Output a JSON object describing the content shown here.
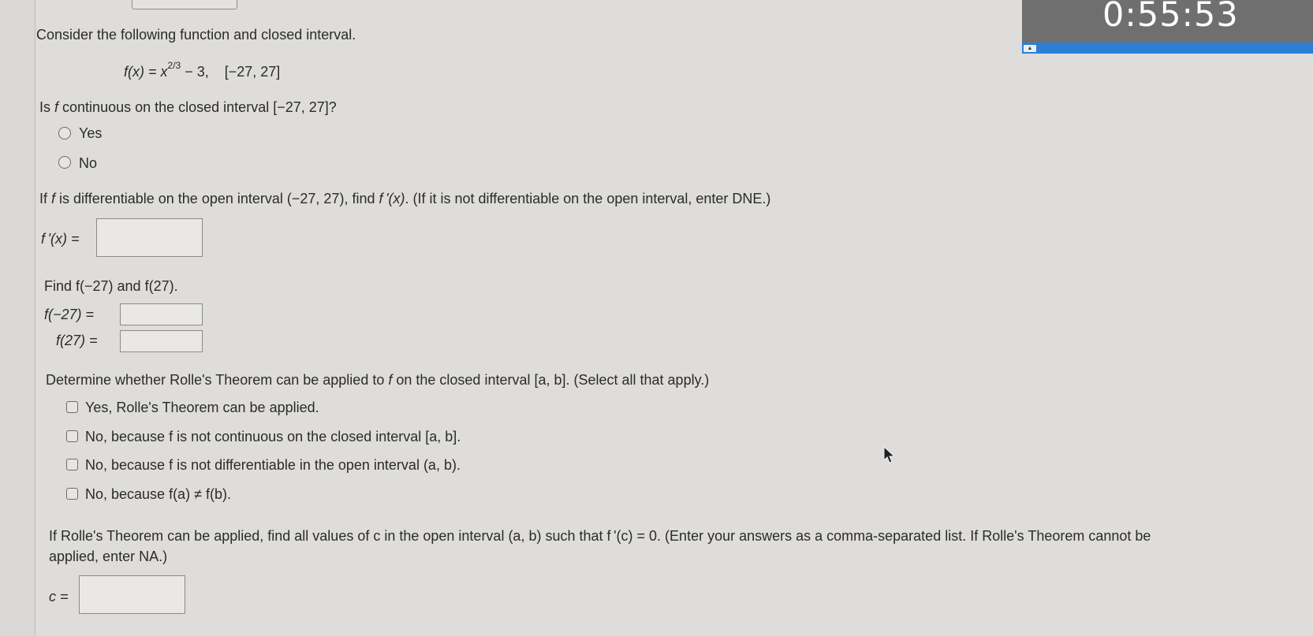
{
  "timer": {
    "value": "0:55:53"
  },
  "intro": "Consider the following function and closed interval.",
  "function": {
    "lhs": "f(x) = x",
    "exponent": "2/3",
    "rhs": " − 3,",
    "interval": "[−27, 27]"
  },
  "q1": {
    "prefix": "Is ",
    "var": "f",
    "suffix": " continuous on the closed interval [−27, 27]?",
    "options": [
      "Yes",
      "No"
    ]
  },
  "q2": {
    "text_a": "If ",
    "text_f": "f",
    "text_b": " is differentiable on the open interval (−27, 27), find ",
    "text_fp": "f '(x)",
    "text_c": ". (If it is not differentiable on the open interval, enter DNE.)",
    "label": "f '(x) =",
    "value": ""
  },
  "q3": {
    "text": "Find f(−27) and f(27).",
    "label1": "f(−27) =",
    "label2": "f(27) =",
    "value1": "",
    "value2": ""
  },
  "q4": {
    "text_a": "Determine whether Rolle's Theorem can be applied to ",
    "text_f": "f",
    "text_b": " on the closed interval [a, b]. (Select all that apply.)",
    "options": [
      "Yes, Rolle's Theorem can be applied.",
      "No, because f is not continuous on the closed interval [a, b].",
      "No, because f is not differentiable in the open interval (a, b).",
      "No, because f(a) ≠ f(b)."
    ]
  },
  "q5": {
    "line1": "If Rolle's Theorem can be applied, find all values of c in the open interval (a, b) such that f '(c) = 0. (Enter your answers as a comma-separated list. If Rolle's Theorem cannot be",
    "line2": "applied, enter NA.)",
    "label": "c =",
    "value": ""
  }
}
